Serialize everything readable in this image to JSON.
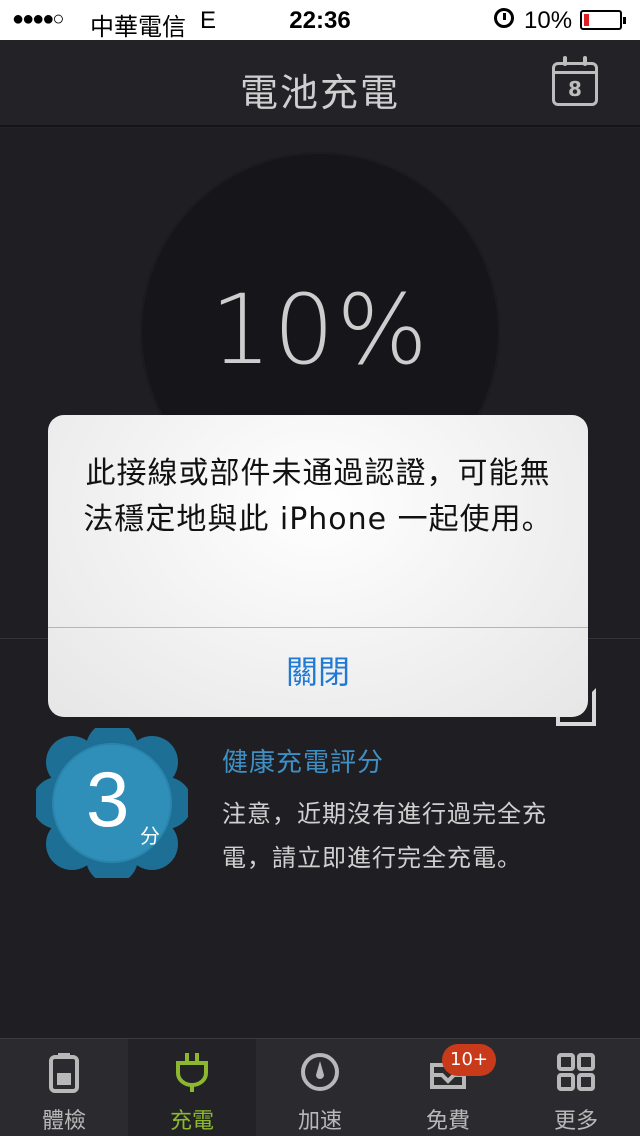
{
  "status_bar": {
    "signal": "●●●●○",
    "carrier": "中華電信",
    "network": "E",
    "time": "22:36",
    "battery_percent": "10%"
  },
  "nav": {
    "title": "電池充電",
    "calendar_day": "8"
  },
  "battery": {
    "level_text": "10%"
  },
  "health": {
    "score": "3",
    "score_unit": "分",
    "title": "健康充電評分",
    "description": "注意，近期沒有進行過完全充電，請立即進行完全充電。"
  },
  "alert": {
    "message": "此接線或部件未通過認證，可能無法穩定地與此 iPhone 一起使用。",
    "button_label": "關閉"
  },
  "tabs": [
    {
      "label": "體檢",
      "icon": "battery-check-icon"
    },
    {
      "label": "充電",
      "icon": "plug-icon"
    },
    {
      "label": "加速",
      "icon": "speed-gauge-icon"
    },
    {
      "label": "免費",
      "icon": "inbox-icon"
    },
    {
      "label": "更多",
      "icon": "grid-icon"
    }
  ],
  "tab_badge": "10+",
  "colors": {
    "accent_blue": "#3d8fc4",
    "active_tab_green": "#8bb82e",
    "badge_red": "#c83a1a",
    "alert_button_blue": "#1f7ad6"
  }
}
